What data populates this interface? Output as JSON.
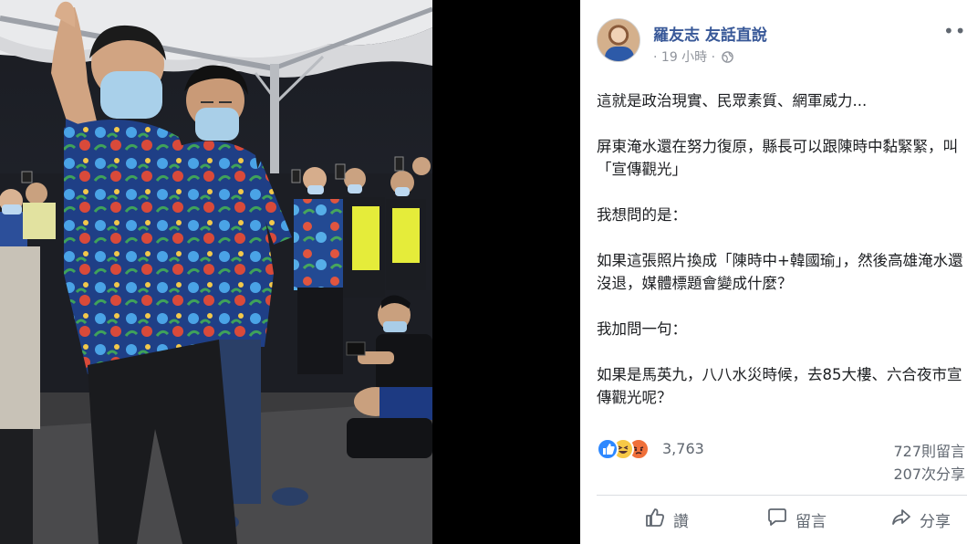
{
  "post": {
    "author": "羅友志 友話直說",
    "time": "19 小時",
    "more": "•••",
    "paragraphs": [
      "這就是政治現實、民眾素質、網軍威力...",
      "屏東淹水還在努力復原，縣長可以跟陳時中黏緊緊，叫「宣傳觀光」",
      "我想問的是：",
      "如果這張照片換成「陳時中+韓國瑜」，然後高雄淹水還沒退，媒體標題會變成什麼？",
      "我加問一句：",
      "如果是馬英九，八八水災時候，去85大樓、六合夜市宣傳觀光呢？"
    ],
    "reaction_count": "3,763",
    "comments": "727則留言",
    "shares": "207次分享"
  },
  "actions": {
    "like": "讚",
    "comment": "留言",
    "share": "分享"
  },
  "colors": {
    "name": "#385898",
    "shirt_blue": "#2d5aa8",
    "floral_red": "#d94a3a"
  }
}
